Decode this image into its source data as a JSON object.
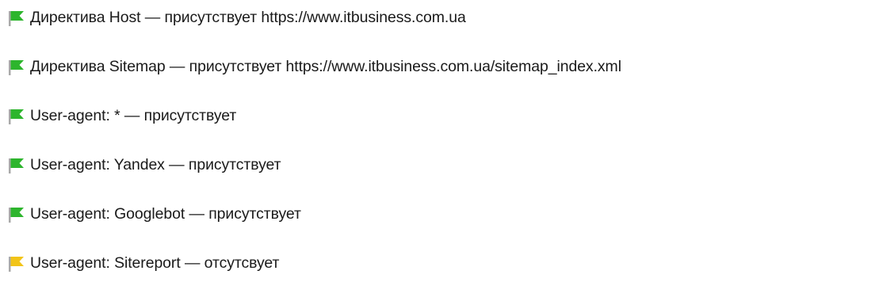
{
  "colors": {
    "present": "#2db52d",
    "present_dark": "#1a8f1a",
    "absent": "#f2c418",
    "absent_dark": "#d9a400",
    "pole": "#aaaaaa"
  },
  "items": [
    {
      "status": "present",
      "icon": "green-flag-icon",
      "text": "Директива Host — присутствует https://www.itbusiness.com.ua"
    },
    {
      "status": "present",
      "icon": "green-flag-icon",
      "text": "Директива Sitemap — присутствует https://www.itbusiness.com.ua/sitemap_index.xml"
    },
    {
      "status": "present",
      "icon": "green-flag-icon",
      "text": "User-agent: * — присутствует"
    },
    {
      "status": "present",
      "icon": "green-flag-icon",
      "text": "User-agent: Yandex — присутствует"
    },
    {
      "status": "present",
      "icon": "green-flag-icon",
      "text": "User-agent: Googlebot — присутствует"
    },
    {
      "status": "absent",
      "icon": "yellow-flag-icon",
      "text": "User-agent: Sitereport — отсутсвует"
    }
  ]
}
